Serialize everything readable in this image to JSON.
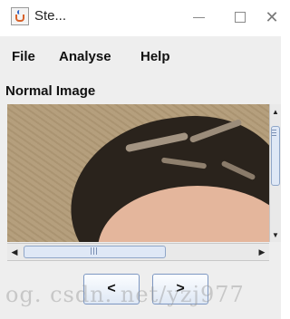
{
  "window": {
    "title": "Ste...",
    "controls": {
      "minimize": "—",
      "maximize": "☐",
      "close": "✕"
    },
    "app_icon": "java-cup-icon"
  },
  "menubar": {
    "items": [
      "File",
      "Analyse",
      "Help"
    ]
  },
  "panel": {
    "label": "Normal Image"
  },
  "image": {
    "content": "photo",
    "scroll": {
      "horizontal": true,
      "vertical": true
    }
  },
  "buttons": {
    "prev": "<",
    "next": ">"
  },
  "watermark": {
    "text": "og. csdn. net/yzj977"
  },
  "colors": {
    "menubar_bg": "#eeeeee",
    "button_border": "#7d97c2",
    "scroll_thumb": "#dfe8f6"
  }
}
